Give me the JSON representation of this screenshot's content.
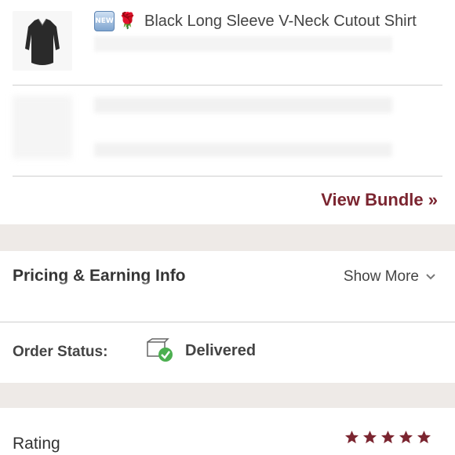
{
  "bundle": {
    "item": {
      "badge_new": "NEW",
      "title": "Black Long Sleeve V-Neck Cutout Shirt"
    },
    "view_bundle_label": "View Bundle »"
  },
  "pricing": {
    "title": "Pricing & Earning Info",
    "show_more_label": "Show More",
    "order_status_label": "Order Status:",
    "order_status_value": "Delivered"
  },
  "rating": {
    "title": "Rating",
    "stars": 5,
    "star_color": "#7b2530"
  },
  "colors": {
    "accent": "#7b2530",
    "delivered_check": "#4caf50"
  }
}
